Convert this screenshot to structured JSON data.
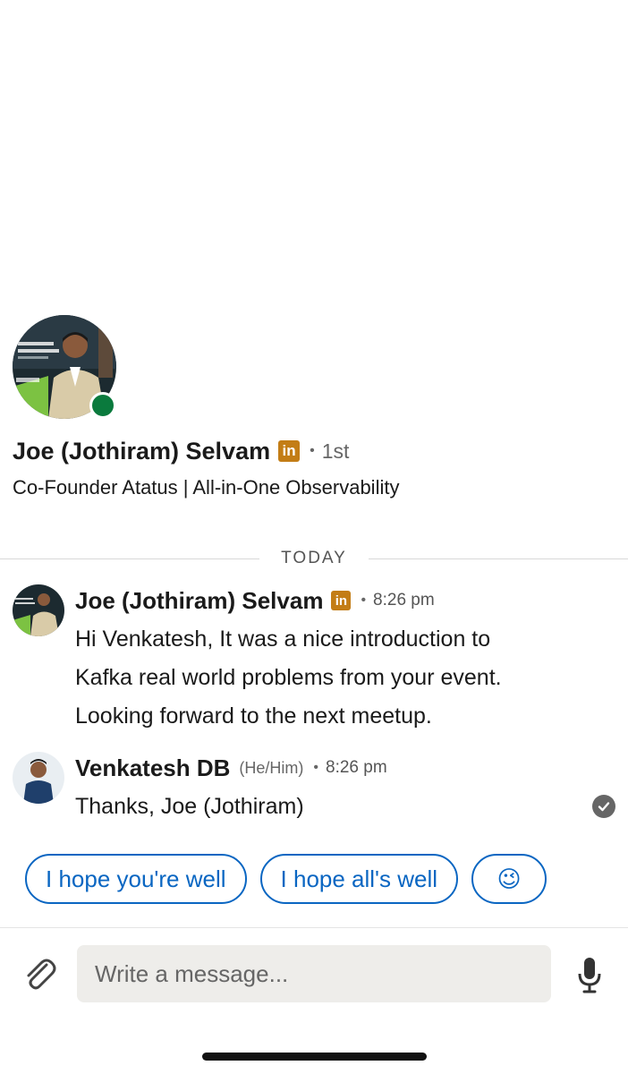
{
  "profile": {
    "name": "Joe (Jothiram) Selvam",
    "badge": "in",
    "separator": "•",
    "degree": "1st",
    "headline": "Co-Founder Atatus | All-in-One Observability",
    "online_color": "#0a7a3d",
    "avatar_caption": "Next-Gen Observ for Modern Syste"
  },
  "divider": {
    "label": "TODAY"
  },
  "messages": [
    {
      "sender": "Joe (Jothiram) Selvam",
      "badge": "in",
      "separator": "•",
      "time": "8:26 pm",
      "lines": [
        "Hi Venkatesh, It was a nice introduction to",
        "Kafka real world problems from your event.",
        "Looking forward to the next meetup."
      ]
    },
    {
      "sender": "Venkatesh DB",
      "pronouns": "(He/Him)",
      "separator": "•",
      "time": "8:26 pm",
      "lines": [
        "Thanks, Joe (Jothiram)"
      ],
      "status_icon": "read-check-icon"
    }
  ],
  "quick_replies": [
    {
      "label": "I hope you're well"
    },
    {
      "label": "I hope all's well"
    },
    {
      "label": "😉"
    }
  ],
  "composer": {
    "placeholder": "Write a message...",
    "attach_icon": "paperclip-icon",
    "mic_icon": "microphone-icon"
  },
  "colors": {
    "accent": "#0a66c2",
    "badge": "#c37d16",
    "online": "#0a7a3d"
  }
}
